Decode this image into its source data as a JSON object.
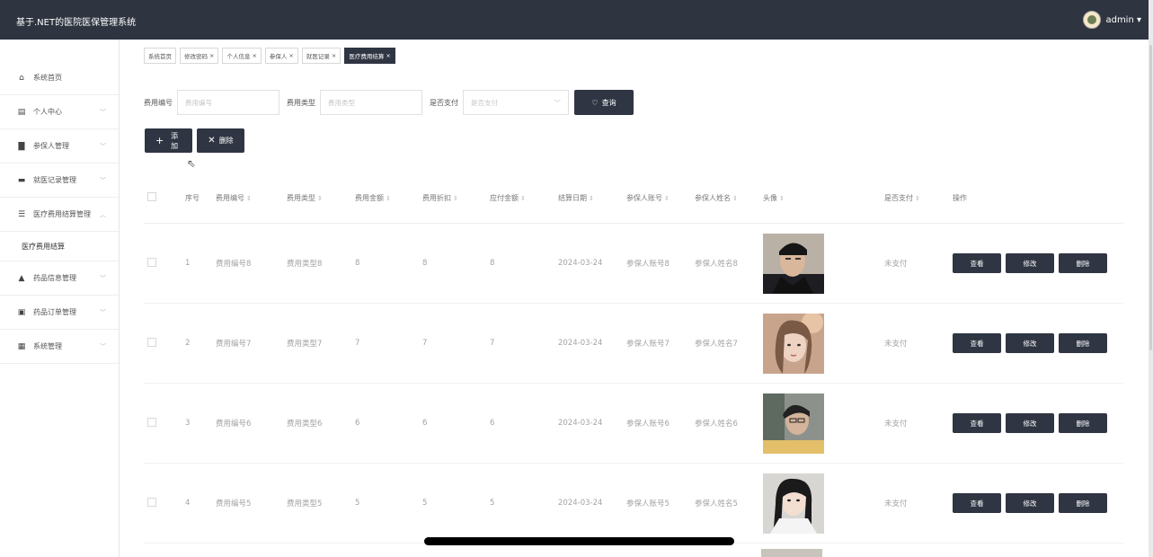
{
  "header": {
    "title": "基于.NET的医院医保管理系统",
    "user": "admin ▾"
  },
  "sidebar": {
    "items": [
      {
        "label": "系统首页",
        "icon": "home-icon",
        "glyph": "⌂",
        "caret": ""
      },
      {
        "label": "个人中心",
        "icon": "calendar-icon",
        "glyph": "▤",
        "caret": "﹀"
      },
      {
        "label": "参保人管理",
        "icon": "clipboard-icon",
        "glyph": "▇",
        "caret": "﹀"
      },
      {
        "label": "就医记录管理",
        "icon": "monitor-icon",
        "glyph": "▬",
        "caret": "﹀"
      },
      {
        "label": "医疗费用结算管理",
        "icon": "sliders-icon",
        "glyph": "☰",
        "caret": "︿"
      },
      {
        "label": "医疗费用结算",
        "submenu": true
      },
      {
        "label": "药品信息管理",
        "icon": "user-icon",
        "glyph": "▲",
        "caret": "﹀"
      },
      {
        "label": "药品订单管理",
        "icon": "clipboard-icon",
        "glyph": "▣",
        "caret": "﹀"
      },
      {
        "label": "系统管理",
        "icon": "grid-icon",
        "glyph": "▦",
        "caret": "﹀"
      }
    ]
  },
  "tabs": [
    {
      "label": "系统首页",
      "closable": false,
      "active": false
    },
    {
      "label": "修改密码",
      "closable": true,
      "active": false
    },
    {
      "label": "个人信息",
      "closable": true,
      "active": false
    },
    {
      "label": "参保人",
      "closable": true,
      "active": false
    },
    {
      "label": "就医记录",
      "closable": true,
      "active": false
    },
    {
      "label": "医疗费用结算",
      "closable": true,
      "active": true
    }
  ],
  "filters": {
    "code_label": "费用编号",
    "code_placeholder": "费用编号",
    "type_label": "费用类型",
    "type_placeholder": "费用类型",
    "paid_label": "是否支付",
    "paid_placeholder": "是否支付",
    "search_label": "查询"
  },
  "actions": {
    "add_label": "添加",
    "delete_label": "删除"
  },
  "table": {
    "columns": [
      "序号",
      "费用编号",
      "费用类型",
      "费用金额",
      "费用折扣",
      "应付金额",
      "结算日期",
      "参保人账号",
      "参保人姓名",
      "头像",
      "是否支付",
      "操作"
    ],
    "rows": [
      {
        "no": "1",
        "code": "费用编号8",
        "type": "费用类型8",
        "amount": "8",
        "discount": "8",
        "payable": "8",
        "date": "2024-03-24",
        "account": "参保人账号8",
        "name": "参保人姓名8",
        "paid": "未支付"
      },
      {
        "no": "2",
        "code": "费用编号7",
        "type": "费用类型7",
        "amount": "7",
        "discount": "7",
        "payable": "7",
        "date": "2024-03-24",
        "account": "参保人账号7",
        "name": "参保人姓名7",
        "paid": "未支付"
      },
      {
        "no": "3",
        "code": "费用编号6",
        "type": "费用类型6",
        "amount": "6",
        "discount": "6",
        "payable": "6",
        "date": "2024-03-24",
        "account": "参保人账号6",
        "name": "参保人姓名6",
        "paid": "未支付"
      },
      {
        "no": "4",
        "code": "费用编号5",
        "type": "费用类型5",
        "amount": "5",
        "discount": "5",
        "payable": "5",
        "date": "2024-03-24",
        "account": "参保人账号5",
        "name": "参保人姓名5",
        "paid": "未支付"
      }
    ],
    "ops": {
      "view": "查看",
      "edit": "修改",
      "delete": "删除"
    }
  }
}
